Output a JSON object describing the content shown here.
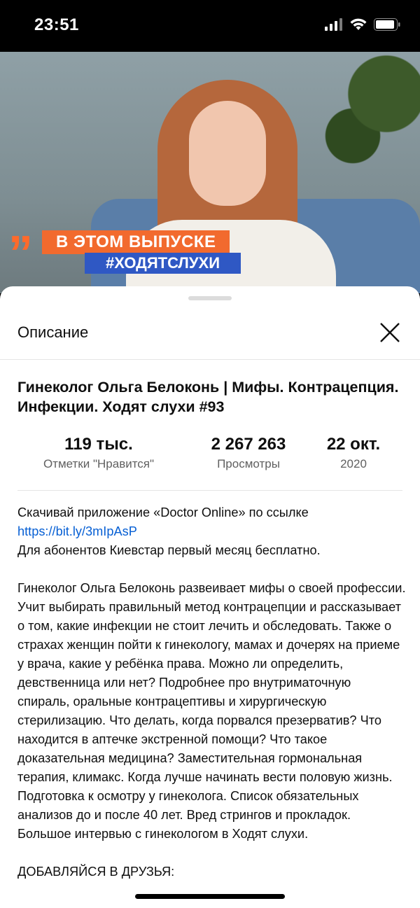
{
  "status_bar": {
    "time": "23:51"
  },
  "video": {
    "banner_top": "В ЭТОМ ВЫПУСКЕ",
    "banner_bottom": "#ХОДЯТСЛУХИ",
    "quote_mark": "”"
  },
  "sheet": {
    "title": "Описание",
    "video_title": "Гинеколог Ольга Белоконь | Мифы. Контрацепция. Инфекции. Ходят слухи #93",
    "stats": [
      {
        "value": "119 тыс.",
        "label": "Отметки \"Нравится\""
      },
      {
        "value": "2 267 263",
        "label": "Просмотры"
      },
      {
        "value": "22 окт.",
        "label": "2020"
      }
    ],
    "description": {
      "line1_text": "Скачивай приложение «Doctor Online» по ссылке ",
      "line1_link": "https://bit.ly/3mIpAsP",
      "line2": "Для абонентов Киевстар первый месяц бесплатно.",
      "paragraph2": "Гинеколог Ольга Белоконь развеивает мифы о своей профессии. Учит выбирать правильный метод контрацепции и рассказывает о том, какие инфекции не стоит лечить и обследовать. Также о страхах женщин пойти к гинекологу, мамах и дочерях на приеме у врача, какие у ребёнка права. Можно ли определить, девственница или нет? Подробнее про внутриматочную спираль, оральные контрацептивы и хирургическую стерилизацию. Что делать, когда порвался презерватив? Что находится в аптечке экстренной помощи? Что такое доказательная медицина? Заместительная гормональная терапия, климакс. Когда лучше начинать вести половую жизнь. Подготовка к осмотру у гинеколога. Список обязательных анализов до и после 40 лет. Вред стрингов и прокладок. Большое интервью с гинекологом в Ходят слухи.",
      "line3": "ДОБАВЛЯЙСЯ В ДРУЗЬЯ:"
    }
  }
}
